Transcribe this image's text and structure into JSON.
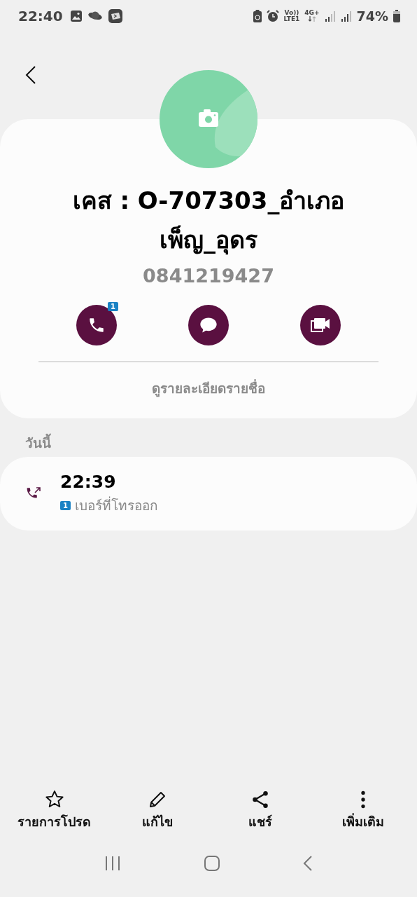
{
  "status_bar": {
    "time": "22:40",
    "volte": "Vo))",
    "lte": "LTE1",
    "network": "4G+",
    "battery": "74%"
  },
  "contact": {
    "name": "เคส : O-707303_อำเภอเพ็ญ_อุดร",
    "phone": "0841219427",
    "link": "ดูรายละเอียดรายชื่อ"
  },
  "actions": [
    {
      "kind": "call",
      "badge": "1"
    },
    {
      "kind": "message"
    },
    {
      "kind": "video"
    }
  ],
  "section_title": "วันนี้",
  "call_log": [
    {
      "kind": "outgoing",
      "time": "22:39",
      "sim": "1",
      "label": "เบอร์ที่โทรออก"
    }
  ],
  "bottom_actions": [
    {
      "kind": "favorite",
      "label": "รายการโปรด"
    },
    {
      "kind": "edit",
      "label": "แก้ไข"
    },
    {
      "kind": "share",
      "label": "แชร์"
    },
    {
      "kind": "more",
      "label": "เพิ่มเติม"
    }
  ]
}
